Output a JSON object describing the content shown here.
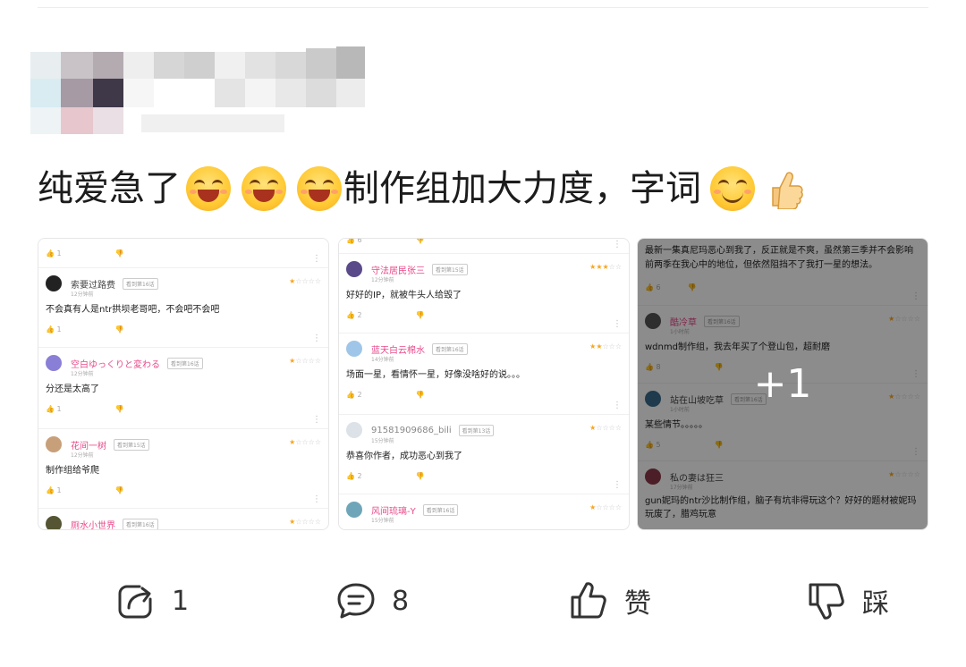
{
  "post": {
    "text_1": "纯爱急了",
    "text_2": "制作组加大力度，字词"
  },
  "screenshot_1": {
    "rows": [
      {
        "user": "",
        "tag": "",
        "time": "",
        "text": "",
        "likes": "1",
        "stars": 0
      },
      {
        "user": "索要过路费",
        "tag": "看到第16话",
        "time": "12分钟前",
        "text": "不会真有人是ntr拱坝老哥吧，不会吧不会吧",
        "likes": "1",
        "stars": 1
      },
      {
        "user": "空白ゆっくりと変わる",
        "tag": "看到第16话",
        "time": "12分钟前",
        "text": "分还是太高了",
        "likes": "1",
        "stars": 1
      },
      {
        "user": "花间一树",
        "tag": "看到第15话",
        "time": "12分钟前",
        "text": "制作组给爷爬",
        "likes": "1",
        "stars": 1
      },
      {
        "user": "厕水小世界",
        "tag": "看到第16话",
        "time": "",
        "text": "",
        "likes": "",
        "stars": 1
      }
    ]
  },
  "screenshot_2": {
    "rows": [
      {
        "user": "守法居民张三",
        "tag": "看到第15话",
        "time": "12分钟前",
        "text": "好好的IP，就被牛头人给毁了",
        "likes": "2",
        "stars": 3
      },
      {
        "user": "蓝天白云棉水",
        "tag": "看到第16话",
        "time": "14分钟前",
        "text": "场面一星，看情怀一星，好像没啥好的说。。。",
        "likes": "2",
        "stars": 2
      },
      {
        "user": "91581909686_bili",
        "tag": "看到第13话",
        "time": "15分钟前",
        "text": "恭喜你作者，成功恶心到我了",
        "likes": "2",
        "stars": 1
      },
      {
        "user": "风间琉璃-Y",
        "tag": "看到第16话",
        "time": "15分钟前",
        "text": "",
        "likes": "",
        "stars": 1
      }
    ]
  },
  "screenshot_3": {
    "top_text": "最新一集真尼玛恶心到我了，反正就是不爽，虽然第三季并不会影响前两季在我心中的地位，但依然阻挡不了我打一星的想法。",
    "rows": [
      {
        "user": "酷冷草",
        "tag": "看到第16话",
        "time": "1小时前",
        "text": "wdnmd制作组，我去年买了个登山包，超耐磨",
        "likes": "8",
        "stars": 1
      },
      {
        "user": "站在山坡吃草",
        "tag": "看到第16话",
        "time": "1小时前",
        "text": "某些情节。。。。。",
        "likes": "5",
        "stars": 1
      },
      {
        "user": "私の妻は狂三",
        "tag": "",
        "time": "17分钟前",
        "text": "gun妮玛的ntr沙比制作组，脑子有坑非得玩这个？好好的题材被妮玛玩废了，腊鸡玩意",
        "likes": "",
        "stars": 1
      }
    ],
    "more_label": "+1"
  },
  "top_likes": "6",
  "actions": {
    "share_count": "1",
    "comment_count": "8",
    "like_label": "赞",
    "dislike_label": "踩"
  }
}
